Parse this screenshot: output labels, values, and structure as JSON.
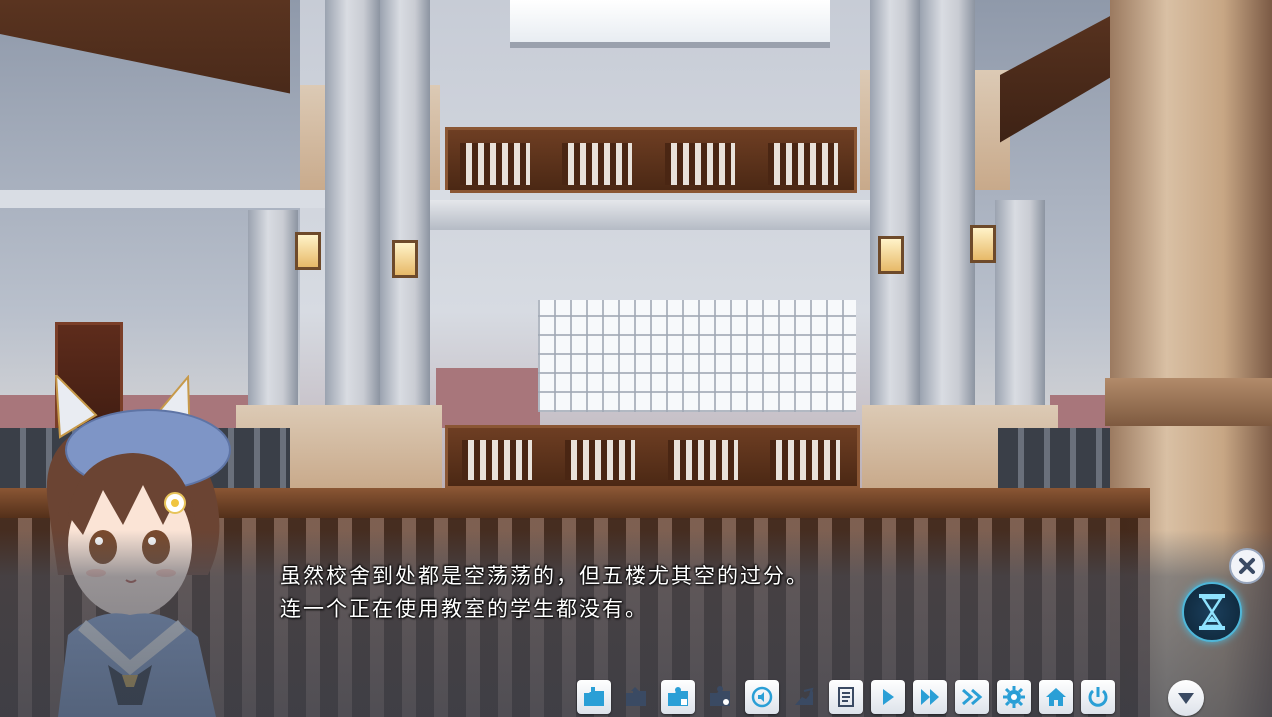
{
  "dialogue": {
    "line1": "虽然校舍到处都是空荡荡的，但五楼尤其空的过分。",
    "line2": "连一个正在使用教室的学生都没有。"
  },
  "toolbar": {
    "buttons": [
      {
        "icon": "quick-save-icon",
        "style": "filled"
      },
      {
        "icon": "quick-load-icon",
        "style": "plain"
      },
      {
        "icon": "save-icon",
        "style": "filled"
      },
      {
        "icon": "load-icon",
        "style": "plain"
      },
      {
        "icon": "voice-replay-icon",
        "style": "filled"
      },
      {
        "icon": "back-icon",
        "style": "plain"
      },
      {
        "icon": "backlog-icon",
        "style": "filled"
      },
      {
        "icon": "auto-play-icon",
        "style": "filled"
      },
      {
        "icon": "skip-icon",
        "style": "filled"
      },
      {
        "icon": "fast-forward-icon",
        "style": "filled"
      },
      {
        "icon": "settings-gear-icon",
        "style": "filled"
      },
      {
        "icon": "title-home-icon",
        "style": "filled"
      },
      {
        "icon": "exit-power-icon",
        "style": "filled"
      }
    ]
  },
  "colors": {
    "icon_accent": "#2a9fd6",
    "icon_dark": "#3a4a63",
    "text": "#ffffff",
    "hourglass_glow": "#4fb7d9"
  }
}
